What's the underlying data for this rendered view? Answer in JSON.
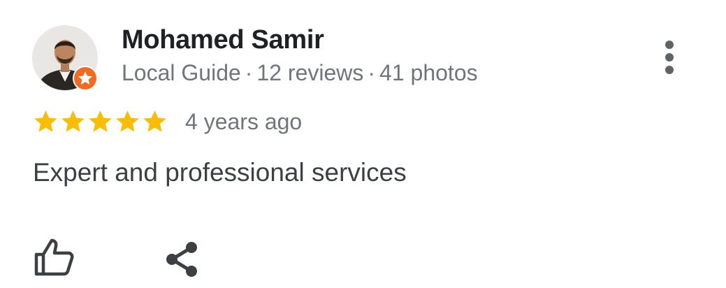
{
  "review": {
    "author_name": "Mohamed Samir",
    "meta": {
      "badge": "Local Guide",
      "reviews": "12 reviews",
      "photos": "41 photos",
      "separator": "·"
    },
    "rating": 5,
    "rating_max": 5,
    "time": "4 years ago",
    "text": "Expert and professional services"
  },
  "icons": {
    "more": "more-vert-icon",
    "like": "thumb-up-icon",
    "share": "share-icon",
    "guide_badge": "local-guide-star-icon",
    "star": "star-icon"
  },
  "colors": {
    "star": "#fbbc04",
    "guide_badge": "#f26b21",
    "author": "#202124",
    "secondary_text": "#70757a",
    "body_text": "#3c4043",
    "icon": "#5f6368"
  }
}
